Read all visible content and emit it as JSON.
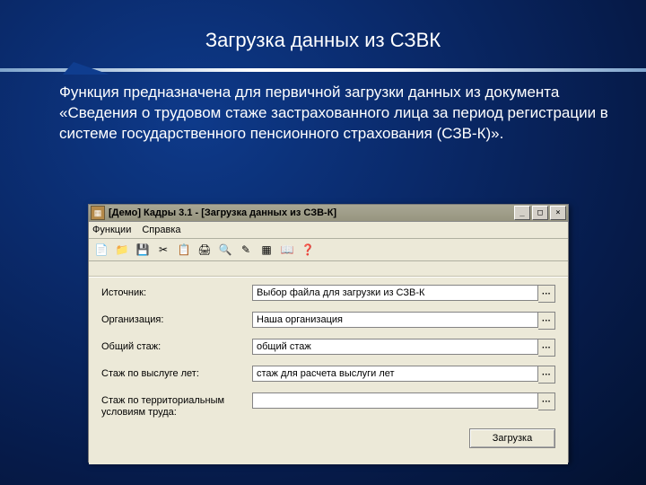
{
  "slide": {
    "title": "Загрузка данных из СЗВК",
    "description": "Функция предназначена для первичной загрузки данных из документа «Сведения о трудовом стаже застрахованного лица за период регистрации в системе государственного пенсионного страхования (СЗВ-К)»."
  },
  "window": {
    "title": "[Демо] Кадры 3.1 - [Загрузка данных из СЗВ-К]",
    "controls": {
      "min": "_",
      "max": "□",
      "close": "×"
    },
    "menu": {
      "functions": "Функции",
      "help": "Справка"
    },
    "toolbar_icons": [
      "📄",
      "📁",
      "💾",
      "✂",
      "📋",
      "🖨",
      "🔍",
      "✎",
      "▦",
      "📖",
      "❓"
    ]
  },
  "form": {
    "rows": [
      {
        "label": "Источник:",
        "value": "Выбор файла для загрузки из СЗВ-К"
      },
      {
        "label": "Организация:",
        "value": "Наша организация"
      },
      {
        "label": "Общий стаж:",
        "value": "общий стаж"
      },
      {
        "label": "Стаж по выслуге лет:",
        "value": "стаж для расчета выслуги лет"
      },
      {
        "label": "Стаж по территориальным условиям труда:",
        "value": ""
      }
    ],
    "ellipsis": "···",
    "load_button": "Загрузка"
  }
}
